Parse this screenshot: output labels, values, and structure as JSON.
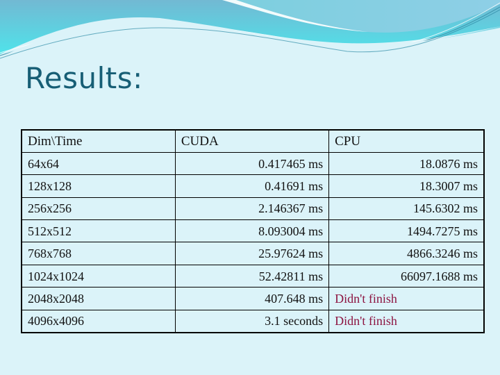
{
  "slide": {
    "title": "Results:"
  },
  "table": {
    "headers": [
      "Dim\\Time",
      "CUDA",
      "CPU"
    ],
    "rows": [
      {
        "dim": "64x64",
        "cuda": "0.417465 ms",
        "cpu": "18.0876 ms",
        "cpu_status": "done"
      },
      {
        "dim": "128x128",
        "cuda": "0.41691 ms",
        "cpu": "18.3007 ms",
        "cpu_status": "done"
      },
      {
        "dim": "256x256",
        "cuda": "2.146367 ms",
        "cpu": "145.6302 ms",
        "cpu_status": "done"
      },
      {
        "dim": "512x512",
        "cuda": "8.093004 ms",
        "cpu": "1494.7275 ms",
        "cpu_status": "done"
      },
      {
        "dim": "768x768",
        "cuda": "25.97624 ms",
        "cpu": "4866.3246 ms",
        "cpu_status": "done"
      },
      {
        "dim": "1024x1024",
        "cuda": "52.42811 ms",
        "cpu": "66097.1688 ms",
        "cpu_status": "done"
      },
      {
        "dim": "2048x2048",
        "cuda": "407.648 ms",
        "cpu": "Didn't finish",
        "cpu_status": "dnf"
      },
      {
        "dim": "4096x4096",
        "cuda": "3.1 seconds",
        "cpu": "Didn't finish",
        "cpu_status": "dnf"
      }
    ]
  },
  "colors": {
    "background": "#dbf3f9",
    "title": "#175e75",
    "did_not_finish": "#8c1340",
    "wave_dark": "#6fb8d0",
    "wave_light": "#52e2ea"
  }
}
